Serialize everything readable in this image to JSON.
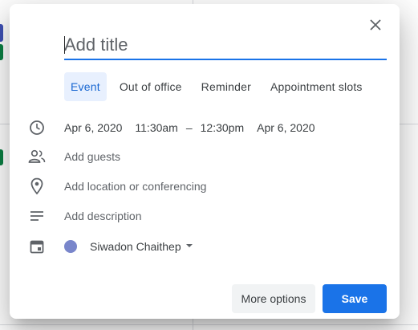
{
  "dialog": {
    "title_placeholder": "Add title",
    "tabs": [
      {
        "label": "Event",
        "active": true
      },
      {
        "label": "Out of office",
        "active": false
      },
      {
        "label": "Reminder",
        "active": false
      },
      {
        "label": "Appointment slots",
        "active": false
      }
    ],
    "datetime": {
      "start_date": "Apr 6, 2020",
      "start_time": "11:30am",
      "separator": "–",
      "end_time": "12:30pm",
      "end_date": "Apr 6, 2020"
    },
    "guests_label": "Add guests",
    "location_label": "Add location or conferencing",
    "description_label": "Add description",
    "calendar": {
      "name": "Siwadon Chaithep",
      "color": "#7986cb"
    },
    "buttons": {
      "more_options": "More options",
      "save": "Save"
    }
  },
  "colors": {
    "accent": "#1a73e8",
    "tab_active_bg": "#e8f0fe"
  }
}
